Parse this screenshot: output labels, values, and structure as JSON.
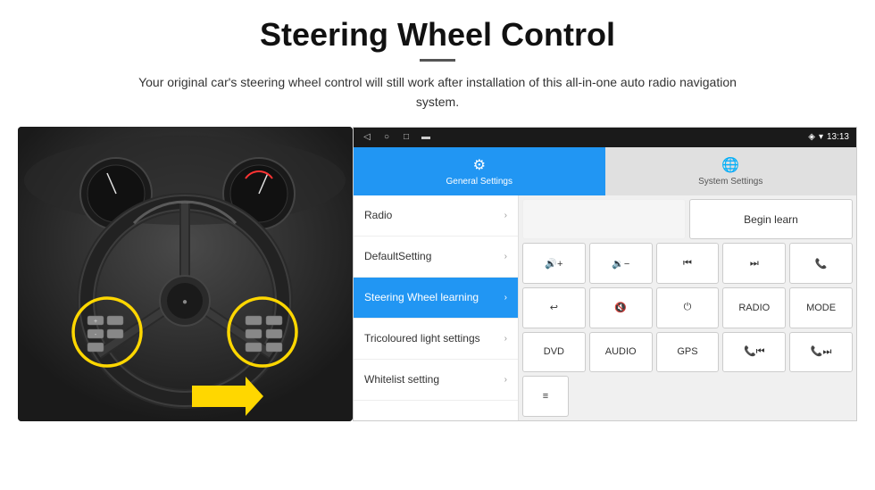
{
  "header": {
    "title": "Steering Wheel Control",
    "subtitle": "Your original car's steering wheel control will still work after installation of this all-in-one auto radio navigation system."
  },
  "android_screen": {
    "status_bar": {
      "nav_back": "◁",
      "nav_home": "○",
      "nav_square": "□",
      "nav_extra": "▬",
      "wifi_icon": "wifi",
      "signal_icon": "signal",
      "time": "13:13"
    },
    "tabs": [
      {
        "id": "general",
        "label": "General Settings",
        "active": true
      },
      {
        "id": "system",
        "label": "System Settings",
        "active": false
      }
    ],
    "menu_items": [
      {
        "id": "radio",
        "label": "Radio",
        "active": false
      },
      {
        "id": "default",
        "label": "DefaultSetting",
        "active": false
      },
      {
        "id": "steering",
        "label": "Steering Wheel learning",
        "active": true
      },
      {
        "id": "tricoloured",
        "label": "Tricoloured light settings",
        "active": false
      },
      {
        "id": "whitelist",
        "label": "Whitelist setting",
        "active": false
      }
    ],
    "button_rows": [
      {
        "id": "row0",
        "buttons": [
          {
            "id": "begin-learn",
            "label": "Begin learn",
            "colspan": 5
          }
        ]
      },
      {
        "id": "row1",
        "buttons": [
          {
            "id": "vol-up",
            "label": "🔊+",
            "is_icon": true
          },
          {
            "id": "vol-down",
            "label": "🔉-",
            "is_icon": true
          },
          {
            "id": "prev-track",
            "label": "⏮",
            "is_icon": true
          },
          {
            "id": "next-track",
            "label": "⏭",
            "is_icon": true
          },
          {
            "id": "phone",
            "label": "📞",
            "is_icon": true
          }
        ]
      },
      {
        "id": "row2",
        "buttons": [
          {
            "id": "hang-up",
            "label": "↩",
            "is_icon": true
          },
          {
            "id": "mute",
            "label": "🔇",
            "is_icon": true
          },
          {
            "id": "power",
            "label": "⏻",
            "is_icon": true
          },
          {
            "id": "radio-btn",
            "label": "RADIO",
            "is_icon": false
          },
          {
            "id": "mode",
            "label": "MODE",
            "is_icon": false
          }
        ]
      },
      {
        "id": "row3",
        "buttons": [
          {
            "id": "dvd",
            "label": "DVD",
            "is_icon": false
          },
          {
            "id": "audio",
            "label": "AUDIO",
            "is_icon": false
          },
          {
            "id": "gps",
            "label": "GPS",
            "is_icon": false
          },
          {
            "id": "phone-prev",
            "label": "📞⏮",
            "is_icon": true
          },
          {
            "id": "phone-next",
            "label": "📞⏭",
            "is_icon": true
          }
        ]
      },
      {
        "id": "row4",
        "buttons": [
          {
            "id": "menu-icon",
            "label": "≡",
            "is_icon": true
          }
        ]
      }
    ]
  }
}
